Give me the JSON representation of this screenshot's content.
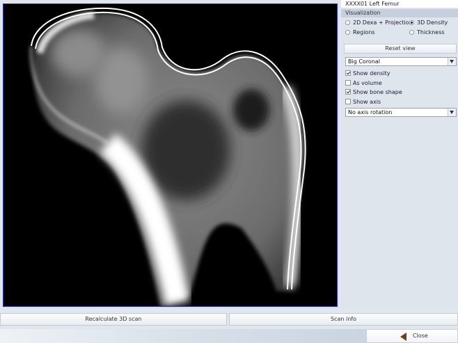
{
  "panel": {
    "title": "XXXX01 Left Femur",
    "section": "Visualization",
    "modes": [
      {
        "label": "2D Dexa + Projection",
        "checked": false
      },
      {
        "label": "3D Density",
        "checked": true
      },
      {
        "label": "Regions",
        "checked": false
      },
      {
        "label": "Thickness",
        "checked": false
      }
    ],
    "reset_label": "Reset view",
    "view_select": "Big Coronal",
    "options": [
      {
        "label": "Show density",
        "checked": true
      },
      {
        "label": "As volume",
        "checked": false
      },
      {
        "label": "Show bone shape",
        "checked": true
      },
      {
        "label": "Show axis",
        "checked": false
      }
    ],
    "rotation_select": "No axis rotation"
  },
  "footer": {
    "recalculate_label": "Recalculate 3D scan",
    "scan_info_label": "Scan info",
    "close_label": "Close"
  },
  "colors": {
    "frame_border": "#2a2fb8",
    "outline": "#ffffff",
    "close_arrow": "#7a3c12"
  },
  "icons": {
    "close": "back-arrow-icon"
  }
}
